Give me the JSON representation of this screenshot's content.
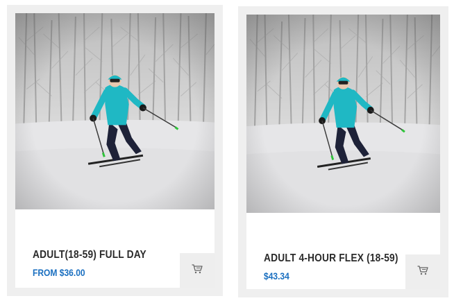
{
  "products": [
    {
      "title": "ADULT(18-59) FULL DAY",
      "price": "FROM $36.00",
      "image": "skier-photo",
      "cart_icon": "cart-icon"
    },
    {
      "title": "ADULT 4-HOUR FLEX (18-59)",
      "price": "$43.34",
      "image": "skier-photo",
      "cart_icon": "cart-icon"
    }
  ],
  "colors": {
    "card_border": "#efefef",
    "title": "#2b2b2b",
    "price": "#1a6fc0",
    "cart_button": "#eeeeee",
    "jacket": "#1fb8c4"
  }
}
